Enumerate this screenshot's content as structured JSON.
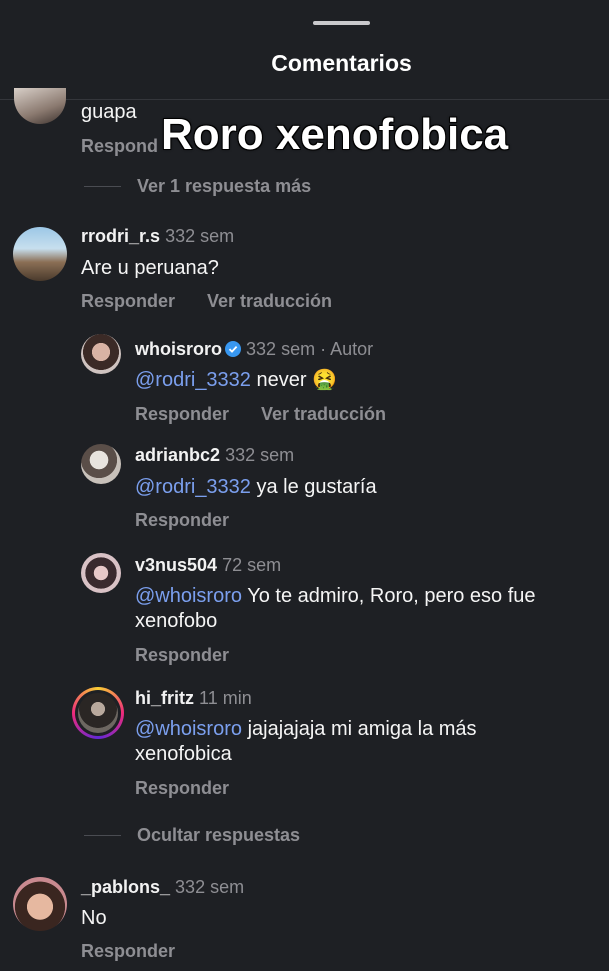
{
  "header": {
    "title": "Comentarios"
  },
  "overlay_caption": "Roro xenofobica",
  "top_partial": {
    "text": "guapa",
    "reply": "Respond"
  },
  "more_replies_label": "Ver 1 respuesta más",
  "comments": [
    {
      "user": "rrodri_r.s",
      "time": "332 sem",
      "text": "Are u peruana?",
      "reply": "Responder",
      "translate": "Ver traducción"
    }
  ],
  "replies": [
    {
      "user": "whoisroro",
      "time": "332 sem",
      "author_tag": "· Autor",
      "mention": "@rodri_3332",
      "text": " never",
      "emoji": "🤮",
      "reply": "Responder",
      "translate": "Ver traducción"
    },
    {
      "user": "adrianbc2",
      "time": "332 sem",
      "mention": "@rodri_3332",
      "text": " ya le gustaría",
      "reply": "Responder"
    },
    {
      "user": "v3nus504",
      "time": "72 sem",
      "mention": "@whoisroro",
      "text_line1": " Yo te admiro, Roro, pero eso fue",
      "text_line2": "xenofobo",
      "reply": "Responder"
    },
    {
      "user": "hi_fritz",
      "time": "11 min",
      "mention": "@whoisroro",
      "text_line1": " jajajajaja mi amiga la más",
      "text_line2": "xenofobica",
      "reply": "Responder"
    }
  ],
  "hide_replies_label": "Ocultar respuestas",
  "last_comment": {
    "user": "_pablons_",
    "time": "332 sem",
    "text": "No",
    "reply": "Responder"
  },
  "colors": {
    "background": "#1e2024",
    "mention": "#7b9fee",
    "secondary": "#8e8e93",
    "verified": "#3897f0"
  }
}
